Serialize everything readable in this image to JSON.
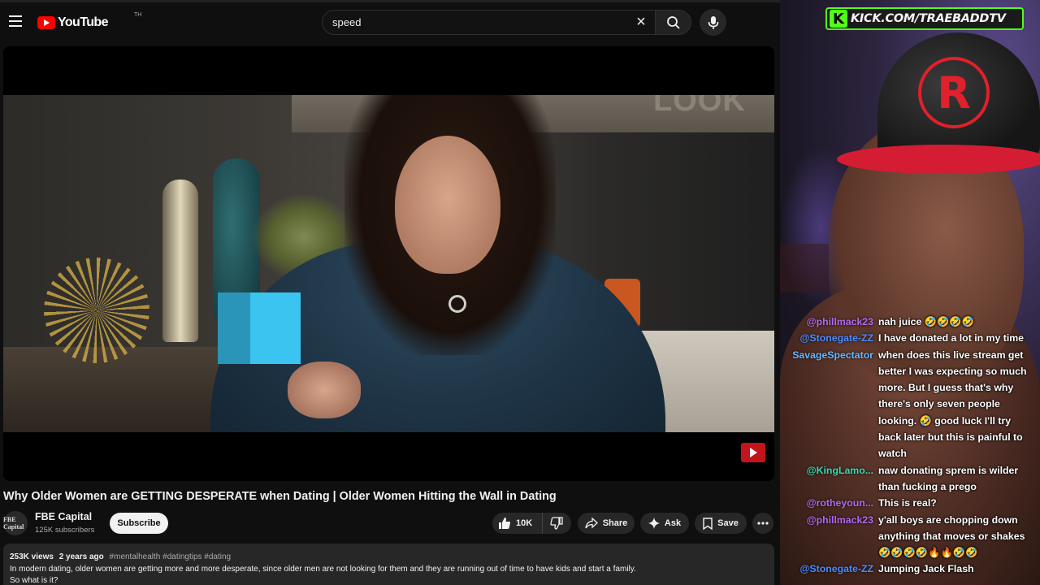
{
  "youtube": {
    "logo_text": "YouTube",
    "logo_tm": "TH",
    "search": {
      "value": "speed"
    },
    "video": {
      "overlay_text": "LOOK",
      "title": "Why Older Women are GETTING DESPERATE when Dating | Older Women Hitting the Wall in Dating"
    },
    "channel": {
      "avatar_text": "FBE Capital",
      "name": "FBE Capital",
      "subscribers": "125K subscribers",
      "subscribe_label": "Subscribe"
    },
    "actions": {
      "likes": "10K",
      "share": "Share",
      "ask": "Ask",
      "save": "Save"
    },
    "description": {
      "views": "253K views",
      "age": "2 years ago",
      "tags": "#mentalhealth #datingtips #dating",
      "line1": "In modern dating, older women are getting more and more desperate, since older men are not looking for them and they are running out of time to have kids and start a family.",
      "line2": "So what is it?"
    }
  },
  "stream": {
    "banner": "KICK.COM/TRAEBADDTV",
    "banner_icon": "K",
    "cap_logo": "R",
    "chat": [
      {
        "user": "@phillmack23",
        "text": "nah juice 🤣🤣🤣🤣",
        "color": "#b06af0"
      },
      {
        "user": "@Stonegate-ZZ",
        "text": "I have donated a lot in my time",
        "color": "#4a8cff"
      },
      {
        "user": "SavageSpectator",
        "text": "when does this live stream get better    I was expecting so much more. But I guess that's why there's only seven people looking. 🤣 good luck I'll try back later but this is painful to watch",
        "color": "#66b8ff"
      },
      {
        "user": "@KingLamo...",
        "text": "naw donating sprem is wilder than fucking a prego",
        "color": "#3ad7b4"
      },
      {
        "user": "@rotheyoun...",
        "text": "This is real?",
        "color": "#b06af0"
      },
      {
        "user": "@phillmack23",
        "text": "y'all boys are chopping down anything that moves or shakes 🤣🤣🤣🤣🔥🔥🤣🤣",
        "color": "#b06af0"
      },
      {
        "user": "@Stonegate-ZZ",
        "text": "Jumping Jack Flash",
        "color": "#4a8cff"
      }
    ]
  }
}
